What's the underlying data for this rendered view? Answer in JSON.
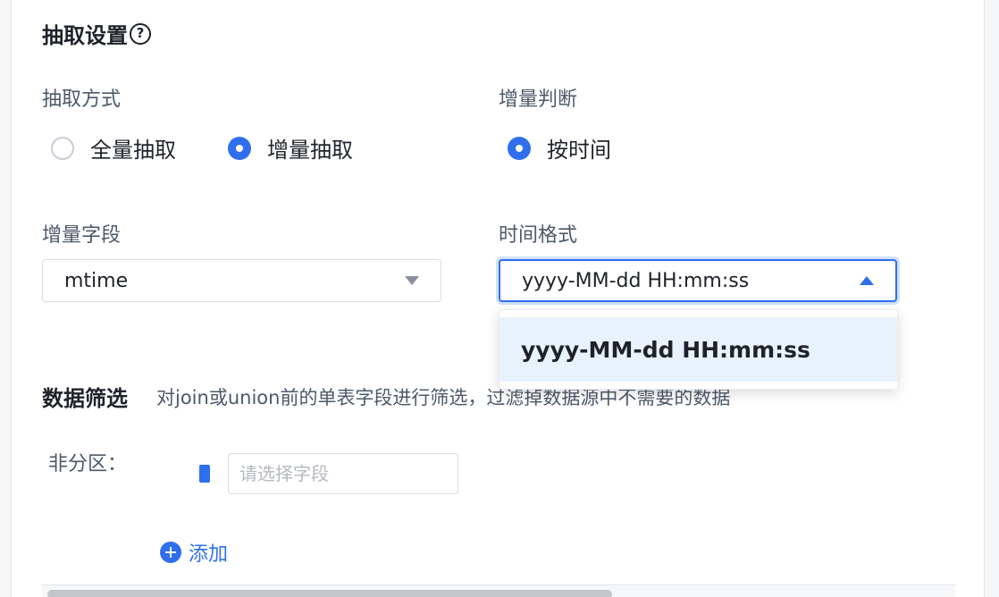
{
  "extract_settings": {
    "title": "抽取设置",
    "help_glyph": "?",
    "method": {
      "label": "抽取方式",
      "options": [
        {
          "label": "全量抽取",
          "checked": false
        },
        {
          "label": "增量抽取",
          "checked": true
        }
      ]
    },
    "incremental_judgement": {
      "label": "增量判断",
      "options": [
        {
          "label": "按时间",
          "checked": true
        }
      ]
    },
    "incremental_field": {
      "label": "增量字段",
      "value": "mtime"
    },
    "time_format": {
      "label": "时间格式",
      "value": "yyyy-MM-dd HH:mm:ss",
      "dropdown_open": true,
      "options": [
        "yyyy-MM-dd HH:mm:ss"
      ]
    }
  },
  "data_filter": {
    "title": "数据筛选",
    "description": "对join或union前的单表字段进行筛选，过滤掉数据源中不需要的数据",
    "non_partition_label": "非分区：",
    "field_placeholder": "请选择字段",
    "add_label": "添加"
  },
  "colors": {
    "accent": "#2f6fed",
    "dropdown_highlight": "#e8f2fd",
    "focus_ring": "#cfe0fb"
  }
}
